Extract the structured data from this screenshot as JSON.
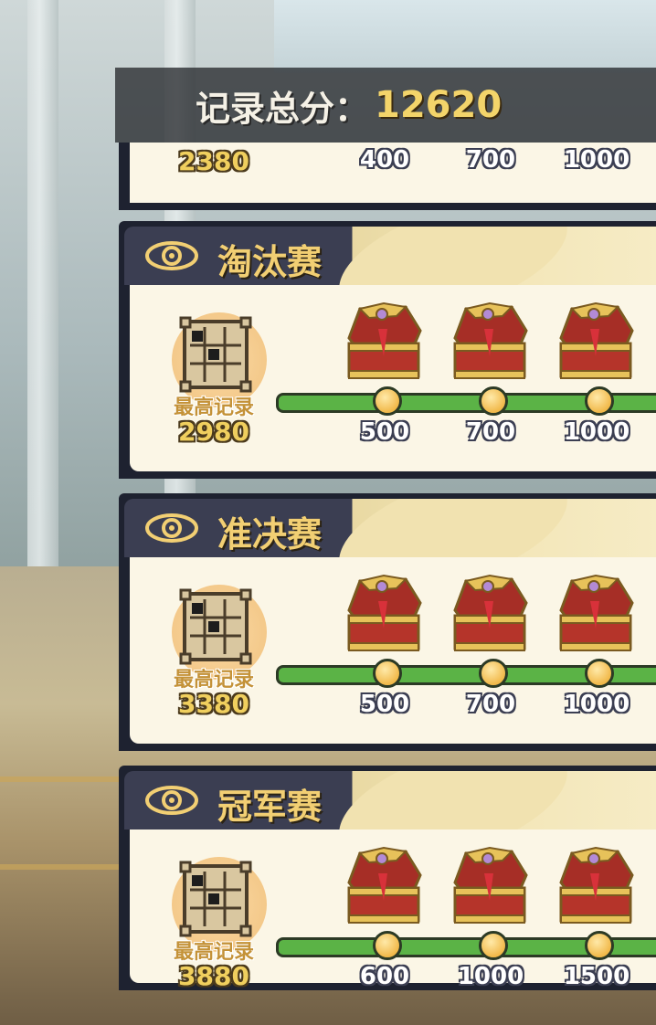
{
  "header": {
    "total_label": "记录总分：",
    "total_value": "12620"
  },
  "clipped_panel": {
    "record_value": "2380",
    "milestones": [
      "400",
      "700",
      "1000"
    ]
  },
  "stages": [
    {
      "title": "淘汰赛",
      "record_label": "最高记录",
      "record_value": "2980",
      "milestones": [
        "500",
        "700",
        "1000"
      ]
    },
    {
      "title": "准决赛",
      "record_label": "最高记录",
      "record_value": "3380",
      "milestones": [
        "500",
        "700",
        "1000"
      ]
    },
    {
      "title": "冠军赛",
      "record_label": "最高记录",
      "record_value": "3880",
      "milestones": [
        "600",
        "1000",
        "1500"
      ]
    }
  ],
  "icons": {
    "eye": "eye-icon",
    "puzzle": "puzzle-grid-icon",
    "chest": "treasure-chest-icon"
  },
  "colors": {
    "accent_gold": "#f2cf73",
    "progress_green": "#5bb346",
    "panel_dark": "#1e2230"
  }
}
